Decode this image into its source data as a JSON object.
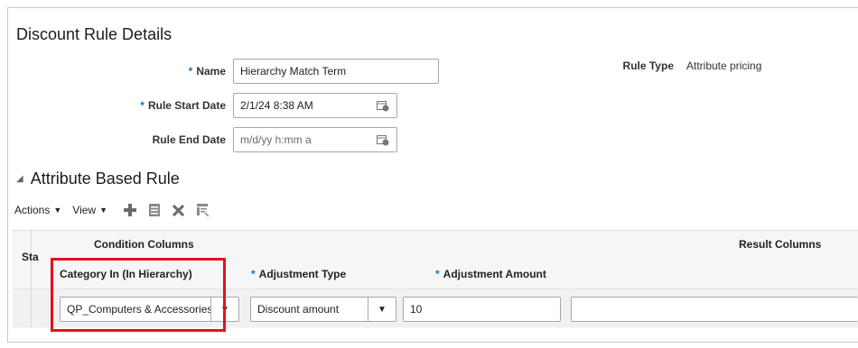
{
  "header": {
    "title": "Discount Rule Details"
  },
  "form": {
    "name_label": "Name",
    "name_value": "Hierarchy Match Term",
    "start_label": "Rule Start Date",
    "start_value": "2/1/24 8:38 AM",
    "end_label": "Rule End Date",
    "end_placeholder": "m/d/yy h:mm a",
    "rule_type_label": "Rule Type",
    "rule_type_value": "Attribute pricing",
    "required_mark": "*"
  },
  "section": {
    "title": "Attribute Based Rule",
    "collapse_icon": "triangle-down-icon"
  },
  "toolbar": {
    "actions_label": "Actions",
    "view_label": "View",
    "icons": [
      "add-icon",
      "detail-icon",
      "delete-icon",
      "freeze-icon"
    ]
  },
  "table": {
    "status_header": "Sta",
    "condition_group": "Condition Columns",
    "result_group": "Result Columns",
    "columns": {
      "category": "Category In (In Hierarchy)",
      "adjustment_type": "Adjustment Type",
      "adjustment_amount": "Adjustment Amount"
    },
    "row": {
      "category_value": "QP_Computers & Accessories",
      "adjustment_type_value": "Discount amount",
      "adjustment_amount_value": "10",
      "result_value": ""
    }
  },
  "colors": {
    "required": "#1a73b8",
    "highlight": "#e3111c"
  }
}
